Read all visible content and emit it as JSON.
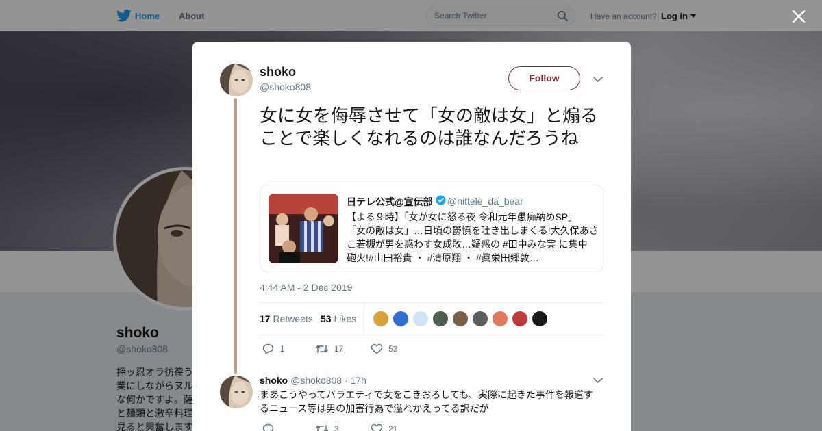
{
  "nav": {
    "home_label": "Home",
    "about_label": "About",
    "search_placeholder": "Search Twitter",
    "account_prompt": "Have an account?",
    "login_label": "Log in"
  },
  "profile": {
    "name": "shoko",
    "handle": "@shoko808",
    "bio_lines": [
      "押ッ忍オラ彷徨う",
      "業にしながらヌル",
      "な何かですよ。薩",
      "と麺類と激辛料理",
      "見ると興奮します"
    ]
  },
  "tweet": {
    "author_name": "shoko",
    "author_handle": "@shoko808",
    "follow_label": "Follow",
    "text": "女に女を侮辱させて「女の敵は女」と煽ることで楽しくなれるのは誰なんだろうね",
    "quoted": {
      "name": "日テレ公式@宣伝部",
      "handle": "@nittele_da_bear",
      "lines": [
        "【よる９時】「女が女に怒る夜 令和元年愚痴納めSP」",
        "「女の敵は女」…日頃の鬱憤を吐き出しまくる!大久保あさ",
        "こ若槻が男を惑わす女成敗…疑惑の #田中みな実 に集中",
        "砲火!#山田裕貴 ・ #清原翔 ・ #眞栄田郷敦…"
      ]
    },
    "timestamp": "4:44 AM - 2 Dec 2019",
    "retweets_count": "17",
    "retweets_label": "Retweets",
    "likes_count": "53",
    "likes_label": "Likes",
    "liker_colors": [
      "#d9a23a",
      "#2f6fd1",
      "#cfe3f6",
      "#4d5f4e",
      "#7a6048",
      "#5c5c5c",
      "#e07a5f",
      "#c23b3b",
      "#1a1a1a"
    ],
    "actions": {
      "replies": "1",
      "retweets": "17",
      "likes": "53"
    }
  },
  "reply": {
    "author_name": "shoko",
    "author_handle": "@shoko808",
    "time": "17h",
    "lines": [
      "まあこうやってバラエティで女をこきおろしても、実際に起きた事件を報道す",
      "るニュース等は男の加害行為で溢れかえってる訳だが"
    ],
    "actions": {
      "replies": "",
      "retweets": "3",
      "likes": "21"
    }
  }
}
